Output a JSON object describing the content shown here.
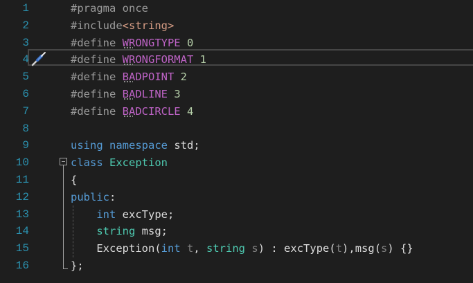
{
  "editor": {
    "lines": [
      {
        "n": "1",
        "tokens": [
          {
            "c": "prep",
            "t": "#pragma once"
          }
        ]
      },
      {
        "n": "2",
        "tokens": [
          {
            "c": "prep",
            "t": "#include"
          },
          {
            "c": "str",
            "t": "<string>"
          }
        ]
      },
      {
        "n": "3",
        "tokens": [
          {
            "c": "prep",
            "t": "#define "
          },
          {
            "c": "macro",
            "t": "WRONGTYPE",
            "sq": true
          },
          {
            "c": "plain",
            "t": " "
          },
          {
            "c": "num",
            "t": "0"
          }
        ]
      },
      {
        "n": "4",
        "tokens": [
          {
            "c": "prep",
            "t": "#define "
          },
          {
            "c": "macro",
            "t": "WRONGFORMAT",
            "sq": true
          },
          {
            "c": "plain",
            "t": " "
          },
          {
            "c": "num",
            "t": "1"
          }
        ]
      },
      {
        "n": "5",
        "tokens": [
          {
            "c": "prep",
            "t": "#define "
          },
          {
            "c": "macro",
            "t": "BADPOINT",
            "sq": true
          },
          {
            "c": "plain",
            "t": " "
          },
          {
            "c": "num",
            "t": "2"
          }
        ]
      },
      {
        "n": "6",
        "tokens": [
          {
            "c": "prep",
            "t": "#define "
          },
          {
            "c": "macro",
            "t": "BADLINE",
            "sq": true
          },
          {
            "c": "plain",
            "t": " "
          },
          {
            "c": "num",
            "t": "3"
          }
        ]
      },
      {
        "n": "7",
        "tokens": [
          {
            "c": "prep",
            "t": "#define "
          },
          {
            "c": "macro",
            "t": "BADCIRCLE",
            "sq": true
          },
          {
            "c": "plain",
            "t": " "
          },
          {
            "c": "num",
            "t": "4"
          }
        ]
      },
      {
        "n": "8",
        "tokens": []
      },
      {
        "n": "9",
        "tokens": [
          {
            "c": "kw",
            "t": "using"
          },
          {
            "c": "plain",
            "t": " "
          },
          {
            "c": "kw",
            "t": "namespace"
          },
          {
            "c": "plain",
            "t": " std;"
          }
        ]
      },
      {
        "n": "10",
        "tokens": [
          {
            "c": "kw",
            "t": "class"
          },
          {
            "c": "plain",
            "t": " "
          },
          {
            "c": "type",
            "t": "Exception"
          }
        ]
      },
      {
        "n": "11",
        "tokens": [
          {
            "c": "plain",
            "t": "{"
          }
        ]
      },
      {
        "n": "12",
        "tokens": [
          {
            "c": "kw",
            "t": "public"
          },
          {
            "c": "plain",
            "t": ":"
          }
        ]
      },
      {
        "n": "13",
        "tokens": [
          {
            "c": "plain",
            "t": "    "
          },
          {
            "c": "kw",
            "t": "int"
          },
          {
            "c": "plain",
            "t": " excType;"
          }
        ]
      },
      {
        "n": "14",
        "tokens": [
          {
            "c": "plain",
            "t": "    "
          },
          {
            "c": "type",
            "t": "string"
          },
          {
            "c": "plain",
            "t": " msg;"
          }
        ]
      },
      {
        "n": "15",
        "tokens": [
          {
            "c": "plain",
            "t": "    Exception("
          },
          {
            "c": "kw",
            "t": "int"
          },
          {
            "c": "plain",
            "t": " "
          },
          {
            "c": "param",
            "t": "t"
          },
          {
            "c": "plain",
            "t": ", "
          },
          {
            "c": "type",
            "t": "string"
          },
          {
            "c": "plain",
            "t": " "
          },
          {
            "c": "param",
            "t": "s"
          },
          {
            "c": "plain",
            "t": ") : excType("
          },
          {
            "c": "param",
            "t": "t"
          },
          {
            "c": "plain",
            "t": "),msg("
          },
          {
            "c": "param",
            "t": "s"
          },
          {
            "c": "plain",
            "t": ") {}"
          }
        ]
      },
      {
        "n": "16",
        "tokens": [
          {
            "c": "plain",
            "t": "};"
          }
        ]
      }
    ]
  },
  "colors": {
    "background": "#1e1e1e",
    "line_number": "#2b91af",
    "preprocessor": "#9b9b9b",
    "macro": "#bd63c5",
    "number": "#b5cea8",
    "string": "#d69d85",
    "keyword": "#569cd6",
    "type": "#4ec9b0",
    "parameter": "#7f7f7f"
  },
  "icons": {
    "quick_action": "screwdriver-icon",
    "fold": "collapse-minus-icon"
  }
}
